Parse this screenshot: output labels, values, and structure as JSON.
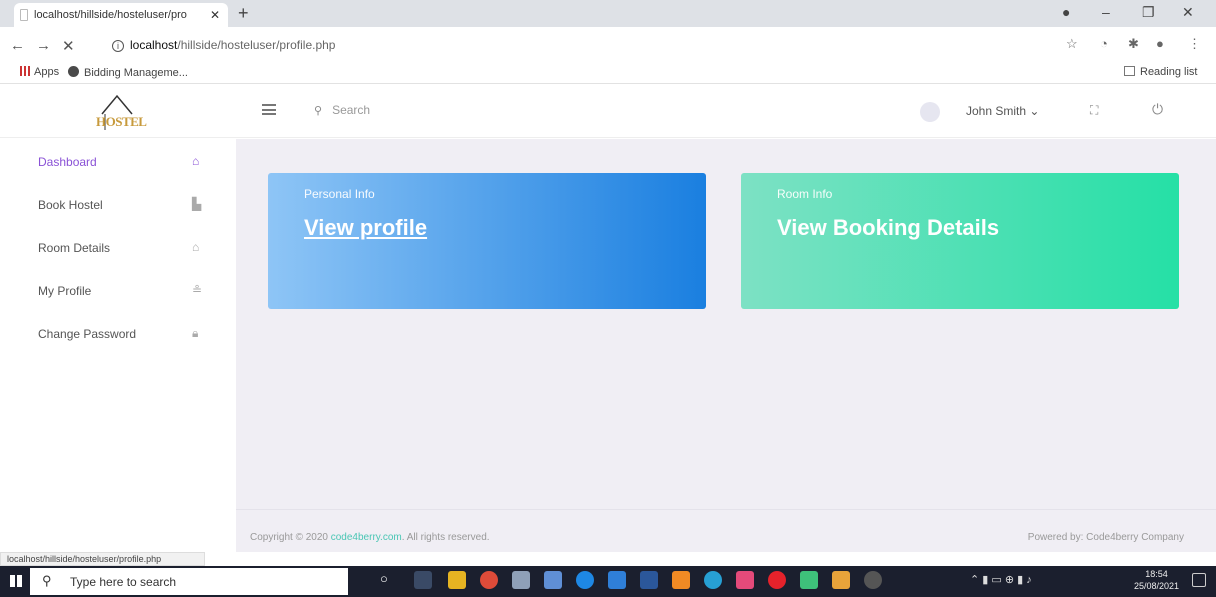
{
  "browser": {
    "tab_title": "localhost/hillside/hosteluser/pro",
    "tab_close": "✕",
    "new_tab": "+",
    "url_host": "localhost",
    "url_path": "/hillside/hosteluser/profile.php",
    "bookmarks": {
      "apps": "Apps",
      "bidding": "Bidding Manageme...",
      "reading_list": "Reading list"
    },
    "status_url": "localhost/hillside/hosteluser/profile.php"
  },
  "app": {
    "logo_text": "HOSTEL",
    "search_placeholder": "Search",
    "user_name": "John Smith ⌄"
  },
  "sidebar": {
    "items": [
      {
        "label": "Dashboard",
        "icon": "home-icon"
      },
      {
        "label": "Book Hostel",
        "icon": "bed-icon"
      },
      {
        "label": "Room Details",
        "icon": "bank-icon"
      },
      {
        "label": "My Profile",
        "icon": "user-icon"
      },
      {
        "label": "Change Password",
        "icon": "lock-icon"
      }
    ]
  },
  "cards": {
    "personal": {
      "subtitle": "Personal Info",
      "title": "View profile"
    },
    "room": {
      "subtitle": "Room Info",
      "title": "View Booking Details"
    }
  },
  "footer": {
    "copy_prefix": "Copyright © 2020 ",
    "copy_link": "code4berry.com",
    "copy_suffix": ". All rights reserved.",
    "powered": "Powered by: Code4berry Company"
  },
  "taskbar": {
    "search_text": "Type here to search",
    "time": "18:54",
    "date": "25/08/2021"
  },
  "colors": {
    "active": "#8a52d6",
    "card_blue": "#1a7fe0",
    "card_green": "#25e0a6"
  }
}
